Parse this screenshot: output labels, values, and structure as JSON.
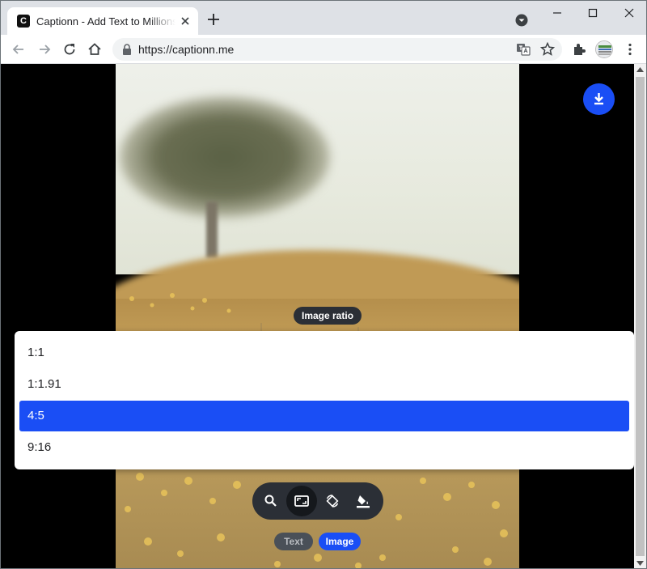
{
  "browser": {
    "tab_title": "Captionn - Add Text to Millions",
    "favicon_letter": "C",
    "url": "https://captionn.me"
  },
  "editor": {
    "tooltip": "Image ratio",
    "ratio_options": [
      {
        "label": "1:1",
        "selected": false
      },
      {
        "label": "1:1.91",
        "selected": false
      },
      {
        "label": "4:5",
        "selected": true
      },
      {
        "label": "9:16",
        "selected": false
      }
    ],
    "tools": [
      {
        "icon": "search-icon",
        "active": false
      },
      {
        "icon": "aspect-ratio-icon",
        "active": true
      },
      {
        "icon": "rotate-icon",
        "active": false
      },
      {
        "icon": "fill-color-icon",
        "active": false
      }
    ],
    "mode_text": "Text",
    "mode_image": "Image",
    "active_mode": "Image"
  },
  "colors": {
    "accent": "#1a4ef5",
    "toolbar_dark": "#2b2f36"
  }
}
